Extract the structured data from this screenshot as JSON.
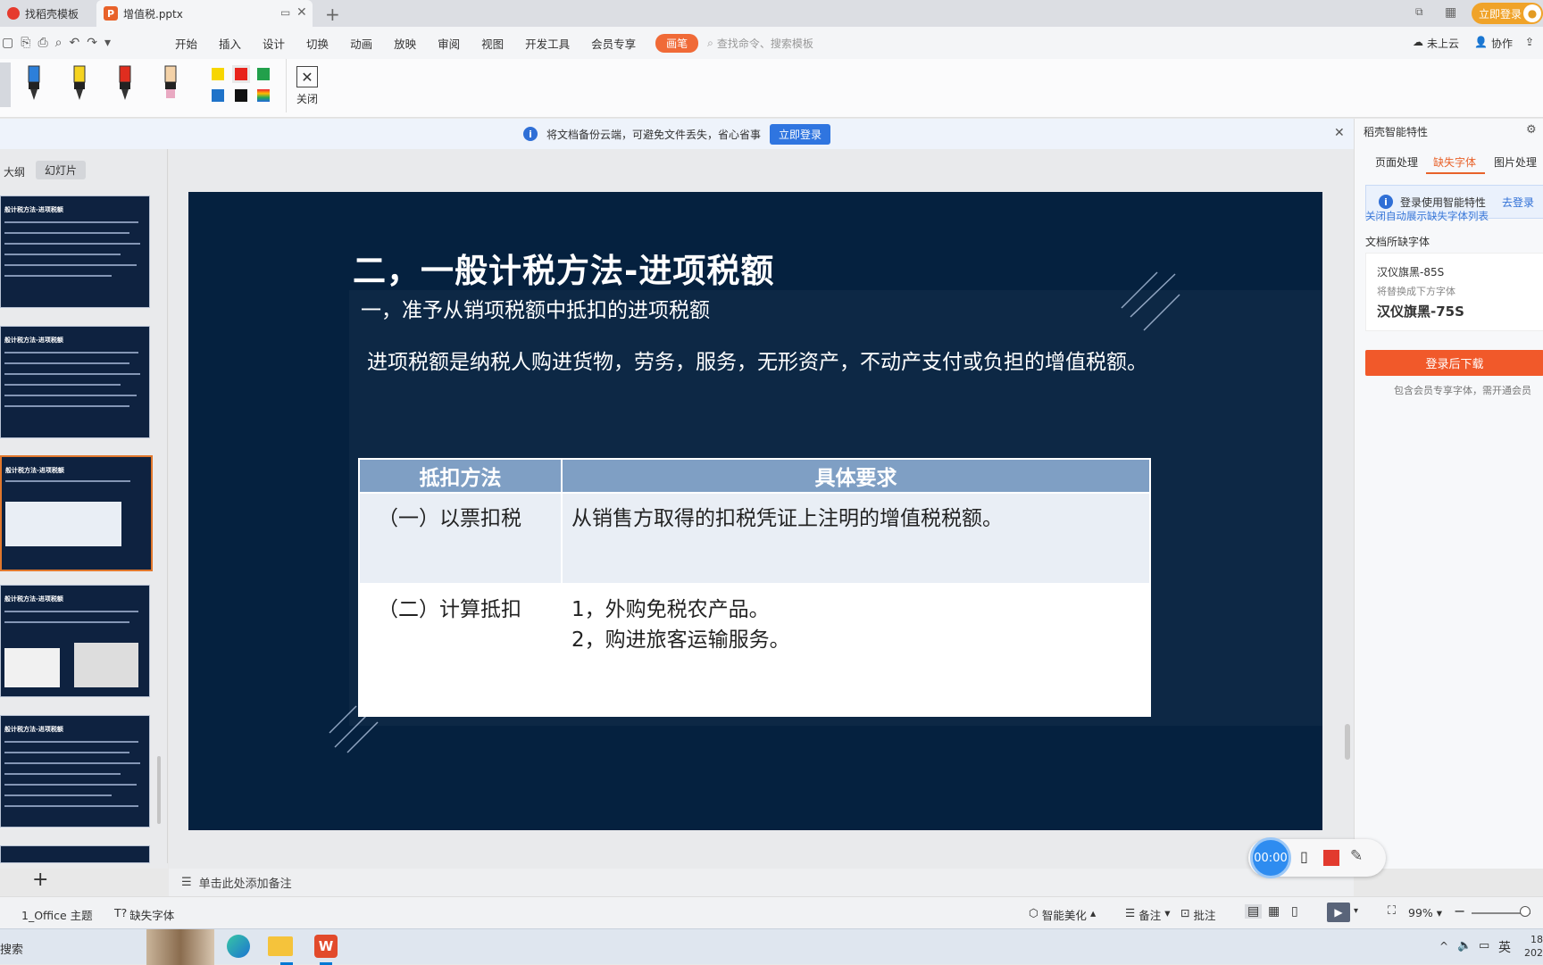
{
  "tabs": [
    {
      "label": "找稻壳模板"
    },
    {
      "label": "增值税.pptx"
    }
  ],
  "header": {
    "login_button": "立即登录"
  },
  "menu": [
    "开始",
    "插入",
    "设计",
    "切换",
    "动画",
    "放映",
    "审阅",
    "视图",
    "开发工具",
    "会员专享"
  ],
  "menu_pill": "画笔",
  "search_placeholder": "查找命令、搜索模板",
  "header_right": {
    "cloud": "未上云",
    "collab": "协作"
  },
  "ribbon": {
    "close_label": "关闭"
  },
  "notice": {
    "text": "将文档备份云端，可避免文件丢失，省心省事",
    "button": "立即登录"
  },
  "left_tabs": {
    "outline": "大纲",
    "slides": "幻灯片"
  },
  "slide": {
    "title": "二，一般计税方法-进项税额",
    "subtitle": "一，准予从销项税额中抵扣的进项税额",
    "body": "进项税额是纳税人购进货物，劳务，服务，无形资产，不动产支付或负担的增值税额。",
    "table": {
      "headers": [
        "抵扣方法",
        "具体要求"
      ],
      "rows": [
        {
          "method": "（一）以票扣税",
          "req1": "从销售方取得的扣税凭证上注明的增值税税额。",
          "req2": ""
        },
        {
          "method": "（二）计算抵扣",
          "req1": "1，外购免税农产品。",
          "req2": "2，购进旅客运输服务。"
        }
      ]
    }
  },
  "thumb_title": "般计税方法-进项税额",
  "notes_placeholder": "单击此处添加备注",
  "right_panel": {
    "header": "稻壳智能特性",
    "tabs": [
      "页面处理",
      "缺失字体",
      "图片处理"
    ],
    "info": "登录使用智能特性",
    "info_link": "去登录",
    "close_link": "关闭自动展示缺失字体列表",
    "section": "文档所缺字体",
    "missing_font": "汉仪旗黑-85S",
    "replace_hint": "将替换成下方字体",
    "replacement": "汉仪旗黑-75S",
    "download_button": "登录后下载",
    "footer": "包含会员专享字体，需开通会员"
  },
  "status": {
    "theme": "1_Office 主题",
    "missing_font": "缺失字体",
    "beautify": "智能美化",
    "notes": "备注",
    "comments": "批注",
    "zoom": "99%"
  },
  "recorder": {
    "time": "00:00"
  },
  "taskbar": {
    "search": "搜索",
    "lang": "英",
    "clock_time": "18",
    "clock_date": "202"
  }
}
